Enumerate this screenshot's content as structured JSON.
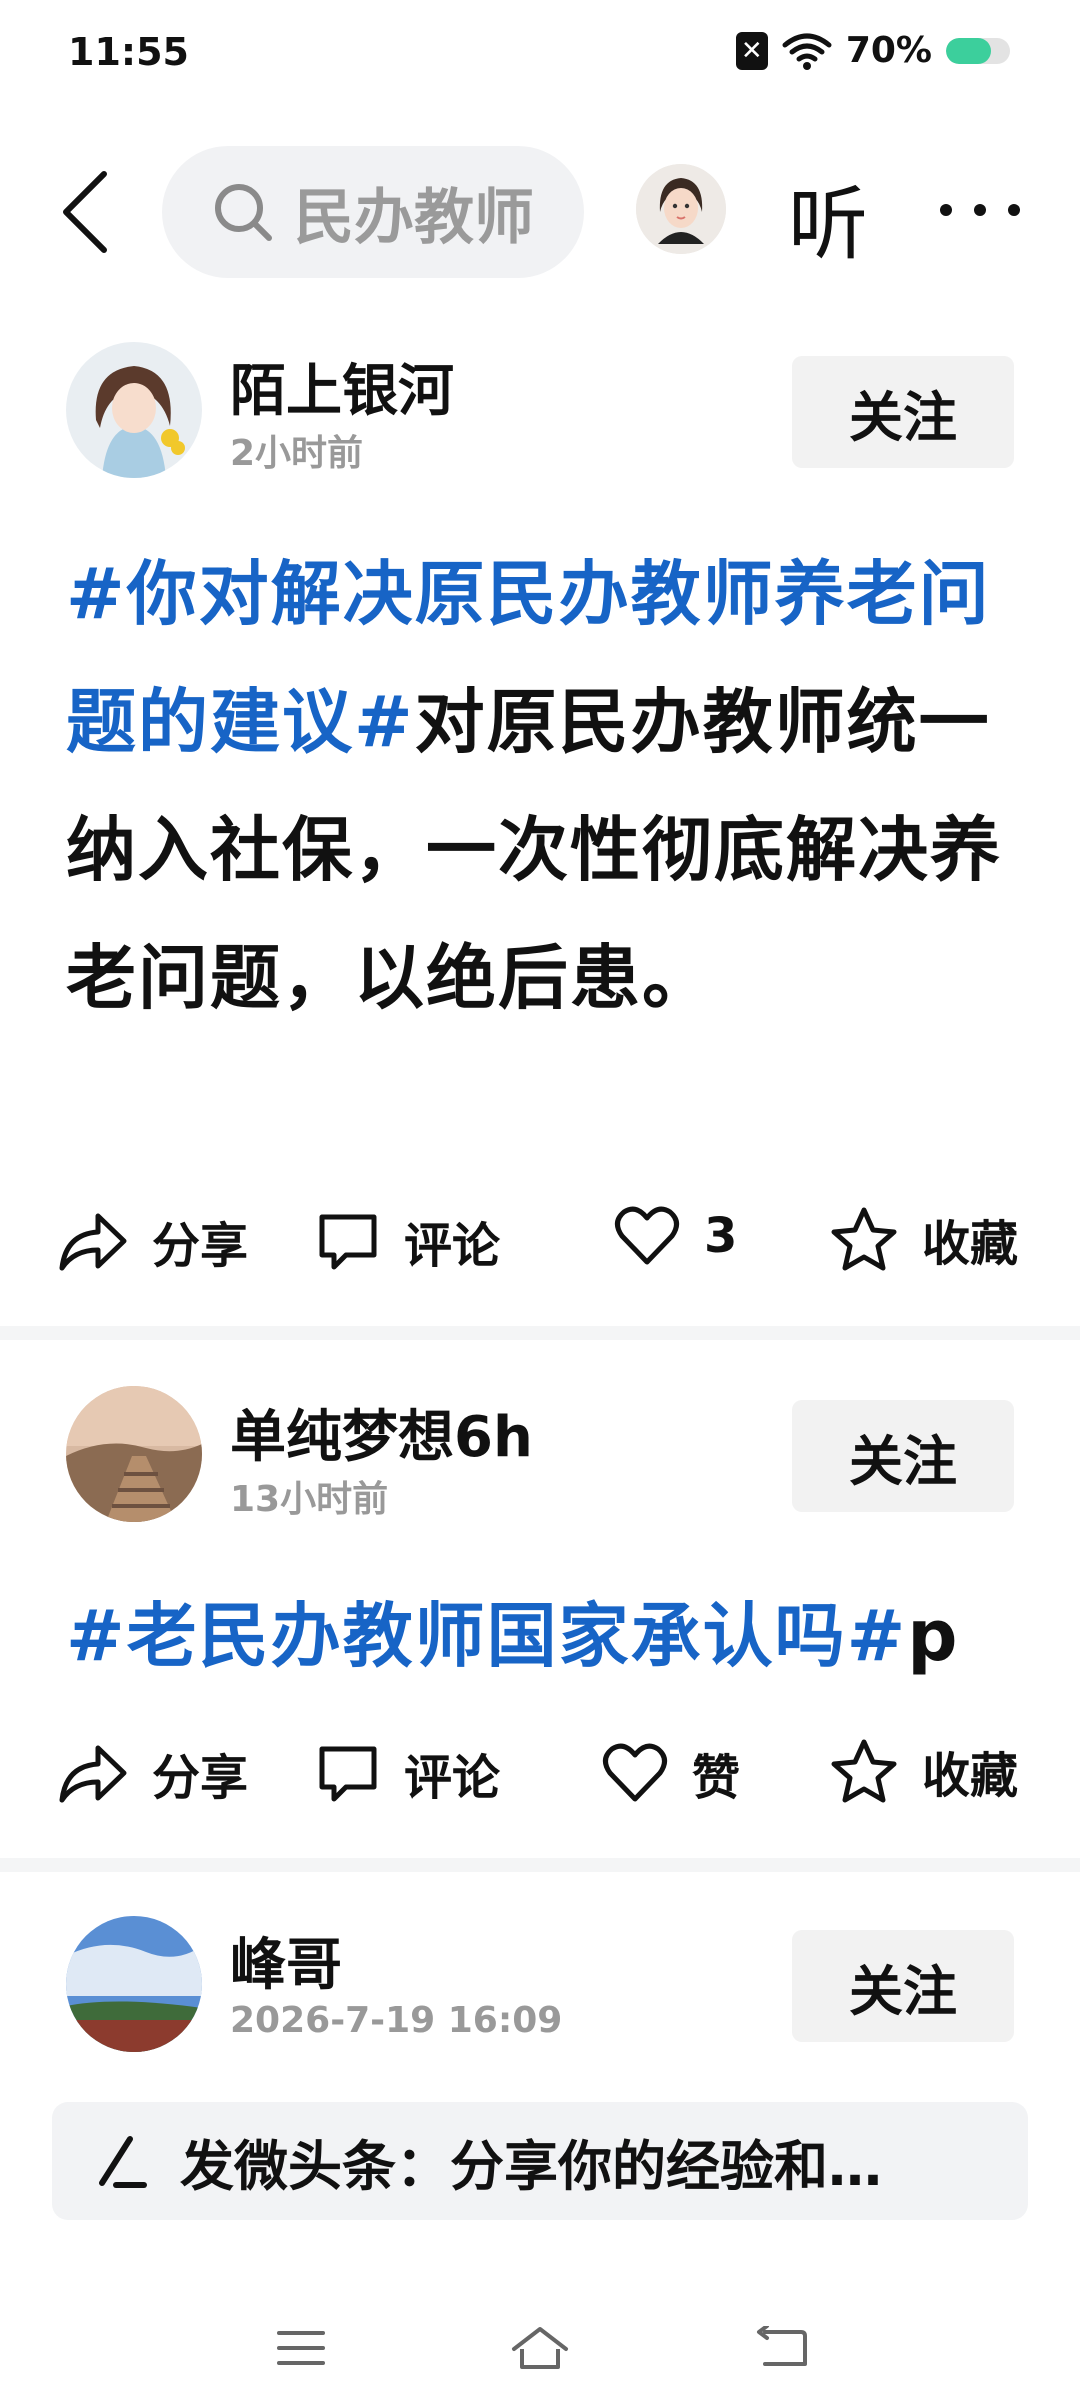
{
  "status_bar": {
    "time": "11:55",
    "battery_pct": "70%",
    "battery_level": 0.7,
    "icons": [
      "sim-x-icon",
      "wifi-icon",
      "battery-icon"
    ]
  },
  "top_nav": {
    "search_text": "民办教师",
    "listen_label": "听",
    "icons": [
      "back-arrow-icon",
      "search-icon",
      "avatar",
      "more-icon"
    ]
  },
  "posts": [
    {
      "author": "陌上银河",
      "time": "2小时前",
      "follow_label": "关注",
      "hashtag": "#你对解决原民办教师养老问题的建议#",
      "body": "对原民办教师统一纳入社保，一次性彻底解决养老问题，以绝后患。",
      "actions": {
        "share": "分享",
        "comment": "评论",
        "like": "3",
        "favorite": "收藏"
      }
    },
    {
      "author": "单纯梦想6h",
      "time": "13小时前",
      "follow_label": "关注",
      "hashtag": "#老民办教师国家承认吗#",
      "body": "p",
      "actions": {
        "share": "分享",
        "comment": "评论",
        "like": "赞",
        "favorite": "收藏"
      }
    },
    {
      "author": "峰哥",
      "time": "2026-7-19  16:09",
      "follow_label": "关注"
    }
  ],
  "composer": {
    "placeholder": "发微头条：分享你的经验和…",
    "icon": "pen-icon"
  },
  "system_nav": {
    "icons": [
      "menu-icon",
      "home-icon",
      "back-icon"
    ]
  },
  "colors": {
    "hashtag": "#1764c6",
    "follow_bg": "#f2f2f2",
    "battery": "#3ccf9c"
  }
}
